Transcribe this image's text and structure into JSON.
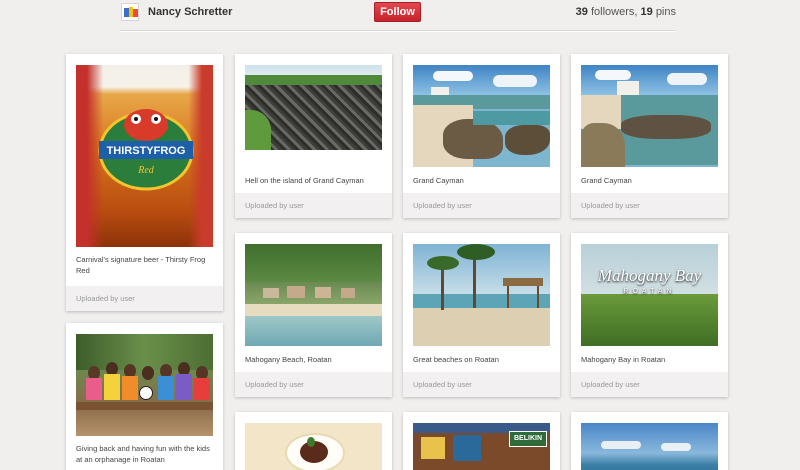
{
  "profile": {
    "name": "Nancy Schretter",
    "follow_label": "Follow",
    "followers_count": "39",
    "followers_label": "followers,",
    "pins_count": "19",
    "pins_label": "pins",
    "accent_color": "#cb2027"
  },
  "pins": [
    {
      "caption": "Carnival's signature beer - Thirsty Frog Red",
      "source": "Uploaded by user",
      "image": "beer-glass-thirsty-frog"
    },
    {
      "caption": "Giving back and having fun with the kids at an orphanage in Roatan",
      "source": "",
      "image": "kids-group-photo"
    },
    {
      "caption": "Hell on the island of Grand Cayman",
      "source": "Uploaded by user",
      "image": "black-rock-formation"
    },
    {
      "caption": "Mahogany Beach, Roatan",
      "source": "Uploaded by user",
      "image": "mahogany-beach"
    },
    {
      "caption": "Grand Cayman",
      "source": "Uploaded by user",
      "image": "cayman-rocky-shore"
    },
    {
      "caption": "Great beaches on Roatan",
      "source": "Uploaded by user",
      "image": "palm-beach"
    },
    {
      "caption": "Grand Cayman",
      "source": "Uploaded by user",
      "image": "cayman-rocky-shore-2"
    },
    {
      "caption": "Mahogany Bay in Roatan",
      "source": "Uploaded by user",
      "image": "mahogany-bay-sign"
    }
  ],
  "logos": {
    "thirsty_frog": "THIRSTYFROG",
    "thirsty_frog_sub": "Red",
    "mahogany_bay_line1": "Mahogany Bay",
    "mahogany_bay_line2": "ROATAN",
    "belikin": "BELIKIN"
  }
}
